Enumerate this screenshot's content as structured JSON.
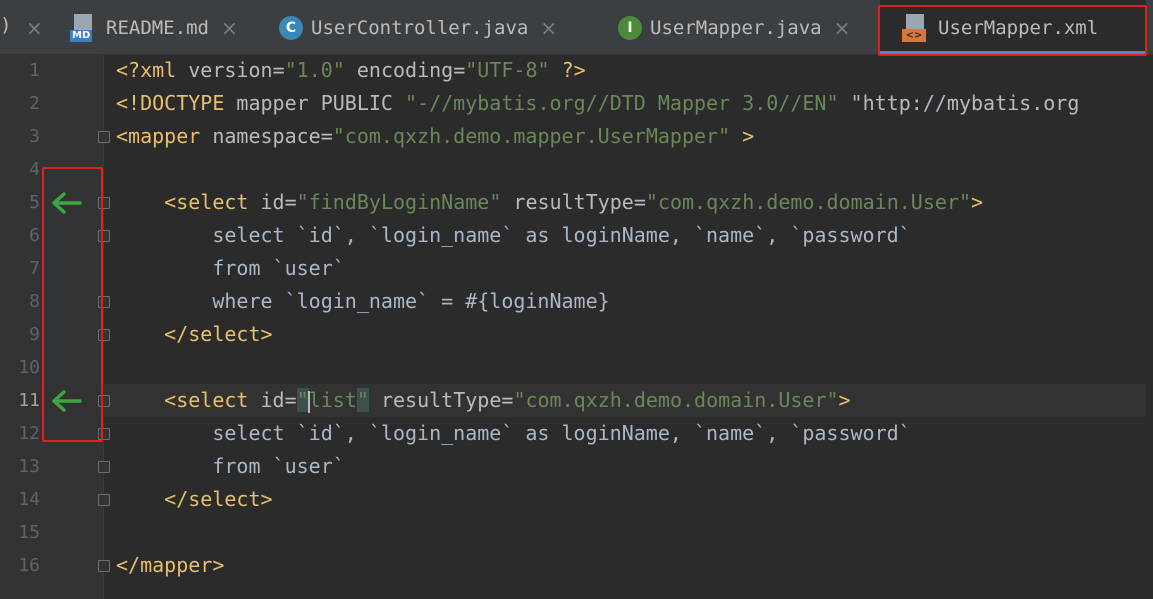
{
  "tabs": [
    {
      "label": "README.md",
      "icon": "markdown-file-icon",
      "icon_text": "MD",
      "active": false
    },
    {
      "label": "UserController.java",
      "icon": "java-class-icon",
      "icon_text": "C",
      "active": false
    },
    {
      "label": "UserMapper.java",
      "icon": "java-interface-icon",
      "icon_text": "I",
      "active": true
    },
    {
      "label": "UserMapper.xml",
      "icon": "xml-file-icon",
      "icon_text": "<>",
      "active": true
    }
  ],
  "close_glyph": "×",
  "editor": {
    "current_line": 11,
    "lines": [
      {
        "n": "1",
        "text": "<?xml version=\"1.0\" encoding=\"UTF-8\" ?>"
      },
      {
        "n": "2",
        "text": "<!DOCTYPE mapper PUBLIC \"-//mybatis.org//DTD Mapper 3.0//EN\" \"http://mybatis.org"
      },
      {
        "n": "3",
        "text": "<mapper namespace=\"com.qxzh.demo.mapper.UserMapper\" >"
      },
      {
        "n": "4",
        "text": ""
      },
      {
        "n": "5",
        "text": "    <select id=\"findByLoginName\" resultType=\"com.qxzh.demo.domain.User\">"
      },
      {
        "n": "6",
        "text": "        select `id`, `login_name` as loginName, `name`, `password`"
      },
      {
        "n": "7",
        "text": "        from `user`"
      },
      {
        "n": "8",
        "text": "        where `login_name` = #{loginName}"
      },
      {
        "n": "9",
        "text": "    </select>"
      },
      {
        "n": "10",
        "text": ""
      },
      {
        "n": "11",
        "text": "    <select id=\"list\" resultType=\"com.qxzh.demo.domain.User\">"
      },
      {
        "n": "12",
        "text": "        select `id`, `login_name` as loginName, `name`, `password`"
      },
      {
        "n": "13",
        "text": "        from `user`"
      },
      {
        "n": "14",
        "text": "    </select>"
      },
      {
        "n": "15",
        "text": ""
      },
      {
        "n": "16",
        "text": "</mapper>"
      }
    ]
  },
  "colors": {
    "tag": "#e8bf6a",
    "attribute": "#bababa",
    "string": "#6a8759",
    "text": "#a9b7c6",
    "gutter_arrow": "#3ea63e",
    "highlight_box": "#e02020"
  }
}
